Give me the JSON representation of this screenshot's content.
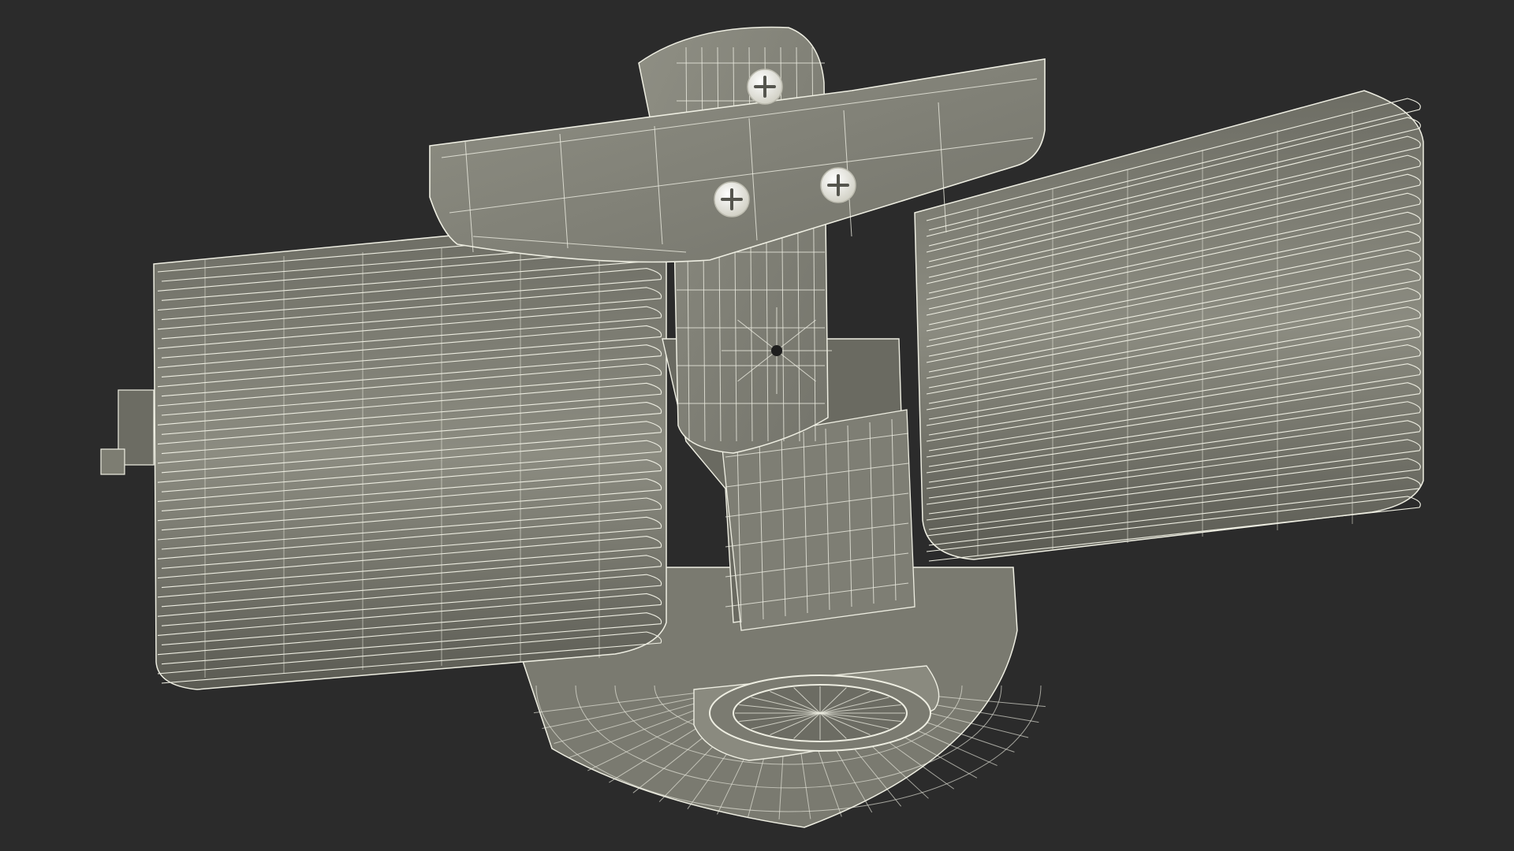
{
  "scene": {
    "subject": "wireframe-render-twin-blower-fan-assembly",
    "background_color": "#2b2b2b",
    "mesh_fill_color": "#85857a",
    "mesh_fill_dark": "#5f5f56",
    "wire_color": "#f2f2e6",
    "screw_color": "#efeee2"
  }
}
